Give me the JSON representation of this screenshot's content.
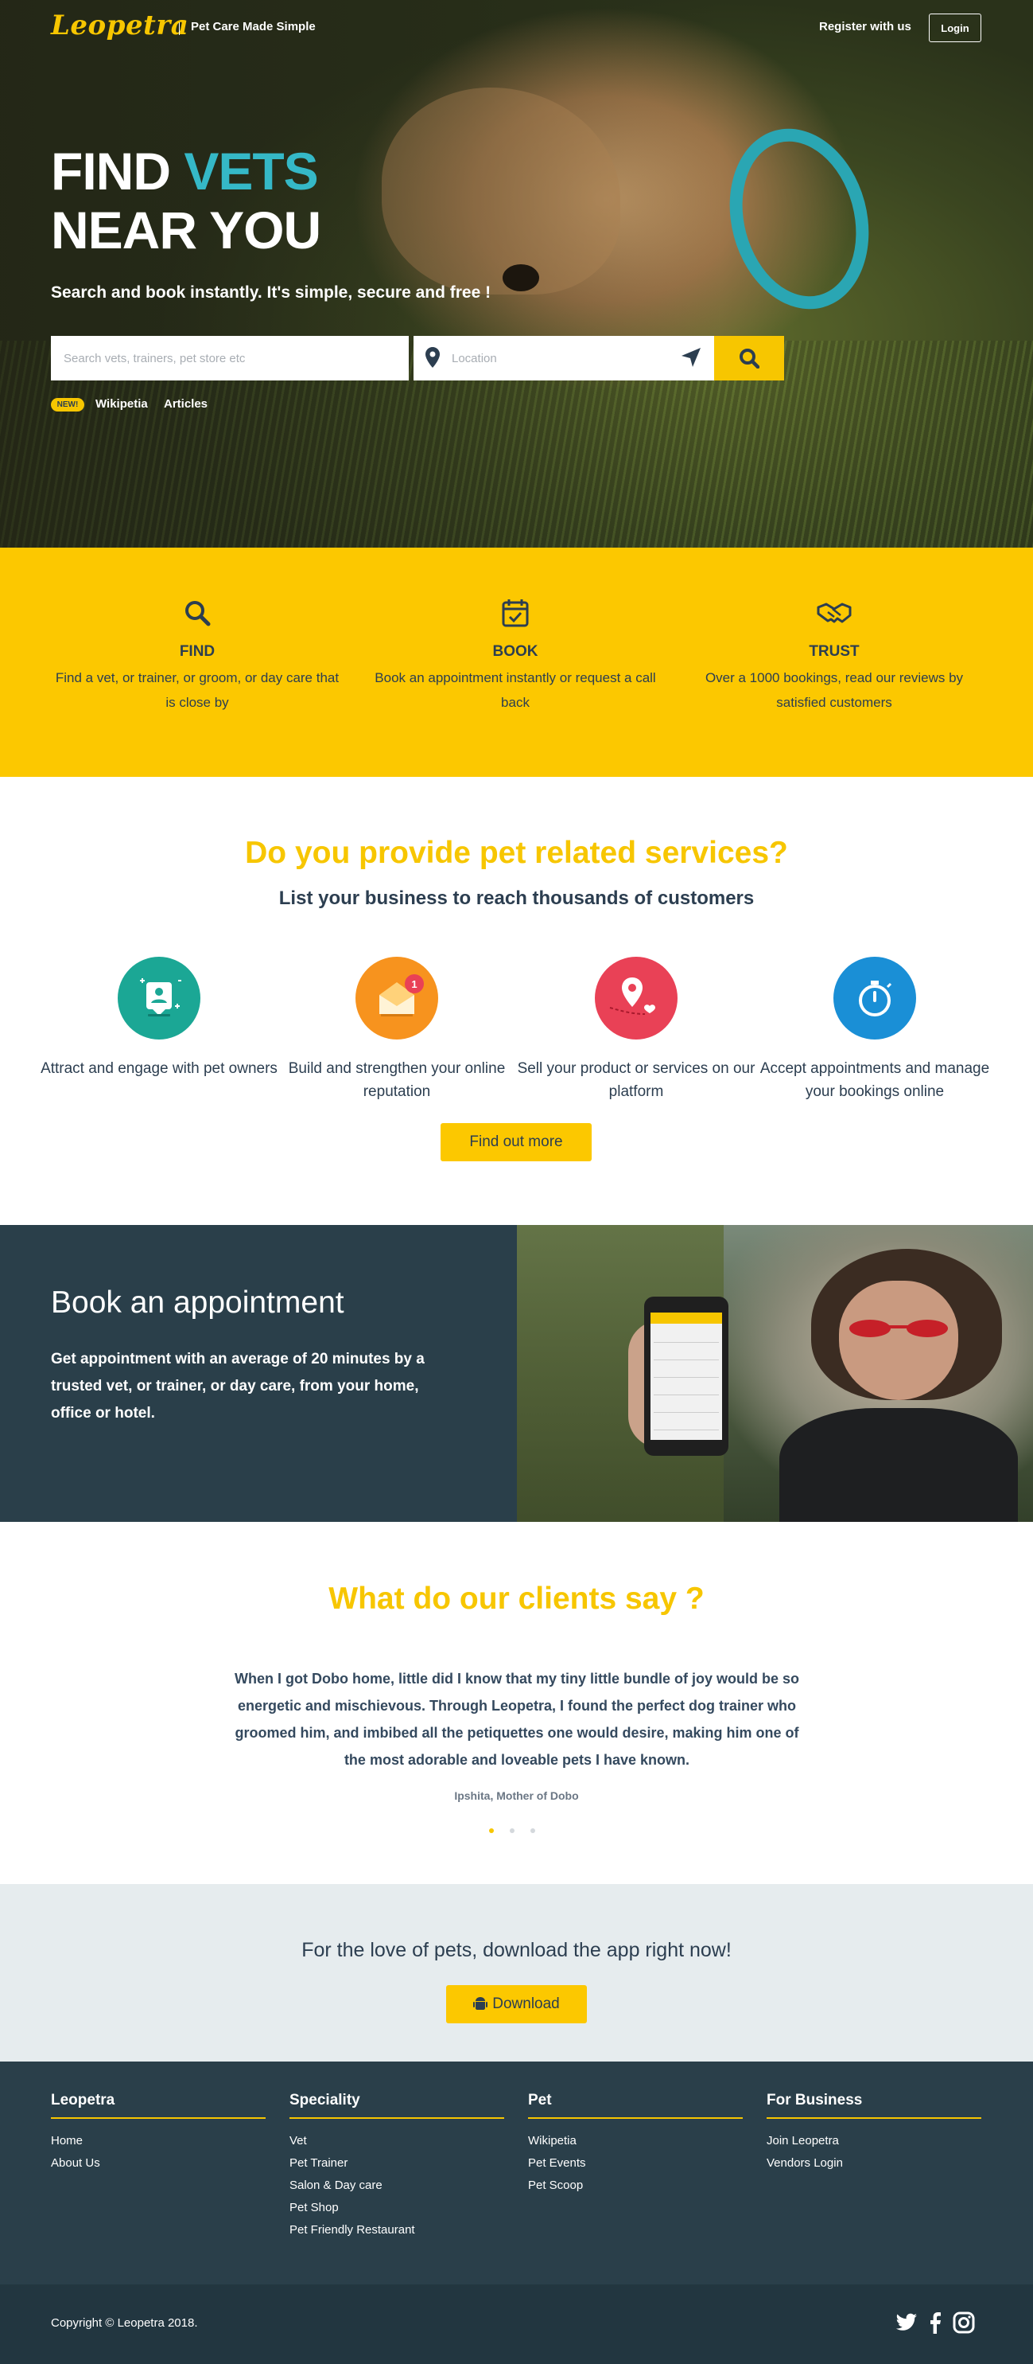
{
  "header": {
    "logo": "Leopetra",
    "tagline": "Pet Care Made Simple",
    "register": "Register with us",
    "login": "Login"
  },
  "hero": {
    "title_line1_a": "FIND ",
    "title_line1_b": "VETS",
    "title_line2": "NEAR YOU",
    "subtitle": "Search and book instantly. It's simple, secure and free !",
    "search_placeholder": "Search vets, trainers, pet store etc",
    "location_placeholder": "Location",
    "badge": "NEW!",
    "link1": "Wikipetia",
    "link2": "Articles"
  },
  "features": [
    {
      "icon": "search-icon",
      "title": "FIND",
      "desc": "Find a vet, or trainer, or groom, or day care that is close by"
    },
    {
      "icon": "calendar-check-icon",
      "title": "BOOK",
      "desc": "Book an appointment instantly or request a call back"
    },
    {
      "icon": "handshake-icon",
      "title": "TRUST",
      "desc": "Over a 1000 bookings, read our reviews by satisfied customers"
    }
  ],
  "services": {
    "title": "Do you provide pet related services?",
    "subtitle": "List your business to reach thousands of customers",
    "items": [
      {
        "icon": "engage-icon",
        "color": "#1ba795",
        "desc": "Attract and engage with pet owners"
      },
      {
        "icon": "reputation-icon",
        "color": "#f7931e",
        "desc": "Build and strengthen your online reputation"
      },
      {
        "icon": "location-heart-icon",
        "color": "#e94156",
        "desc": "Sell your product or services on our platform"
      },
      {
        "icon": "stopwatch-icon",
        "color": "#1a8fd6",
        "desc": "Accept appointments and manage your bookings online"
      }
    ],
    "badge_count": "1",
    "button": "Find out more"
  },
  "appointment": {
    "title": "Book an appointment",
    "desc": "Get appointment with an average of 20 minutes by a trusted vet, or trainer, or day care, from your home, office or hotel."
  },
  "testimonial": {
    "title": "What do our clients say ?",
    "quote": "When I got Dobo home, little did I know that my tiny little bundle of joy would be so energetic and mischievous. Through Leopetra, I found the perfect dog trainer who groomed him, and imbibed all the petiquettes one would desire, making him one of the most adorable and loveable pets I have known.",
    "author": "Ipshita, Mother of Dobo"
  },
  "download": {
    "text": "For the love of pets, download the app right now!",
    "button": "Download"
  },
  "footer": {
    "columns": [
      {
        "heading": "Leopetra",
        "links": [
          "Home",
          "About Us"
        ]
      },
      {
        "heading": "Speciality",
        "links": [
          "Vet",
          "Pet Trainer",
          "Salon & Day care",
          "Pet Shop",
          "Pet Friendly Restaurant"
        ]
      },
      {
        "heading": "Pet",
        "links": [
          "Wikipetia",
          "Pet Events",
          "Pet Scoop"
        ]
      },
      {
        "heading": "For Business",
        "links": [
          "Join Leopetra",
          "Vendors Login"
        ]
      }
    ],
    "copyright": "Copyright © Leopetra 2018."
  },
  "colors": {
    "accent": "#f7c600",
    "teal": "#35b8c7",
    "dark": "#2a3f4a"
  }
}
